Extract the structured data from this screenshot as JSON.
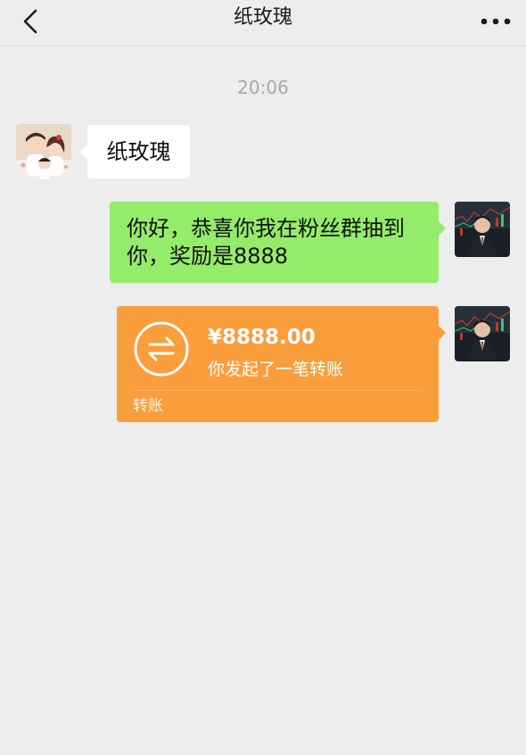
{
  "header": {
    "title": "纸玫瑰"
  },
  "chat": {
    "timestamp": "20:06",
    "messages": [
      {
        "side": "left",
        "text": "纸玫瑰"
      },
      {
        "side": "right",
        "line1": "你好，恭喜你我在粉丝群抽到",
        "line2": "你，奖励是8888"
      }
    ],
    "transfer": {
      "amount": "¥8888.00",
      "description": "你发起了一笔转账",
      "footer": "转账"
    }
  },
  "colors": {
    "background": "#ededed",
    "right_bubble": "#95ec69",
    "left_bubble": "#ffffff",
    "transfer_card": "#fa9d3b"
  },
  "icons": [
    "back-arrow-icon",
    "more-options-icon",
    "transfer-arrows-icon"
  ]
}
